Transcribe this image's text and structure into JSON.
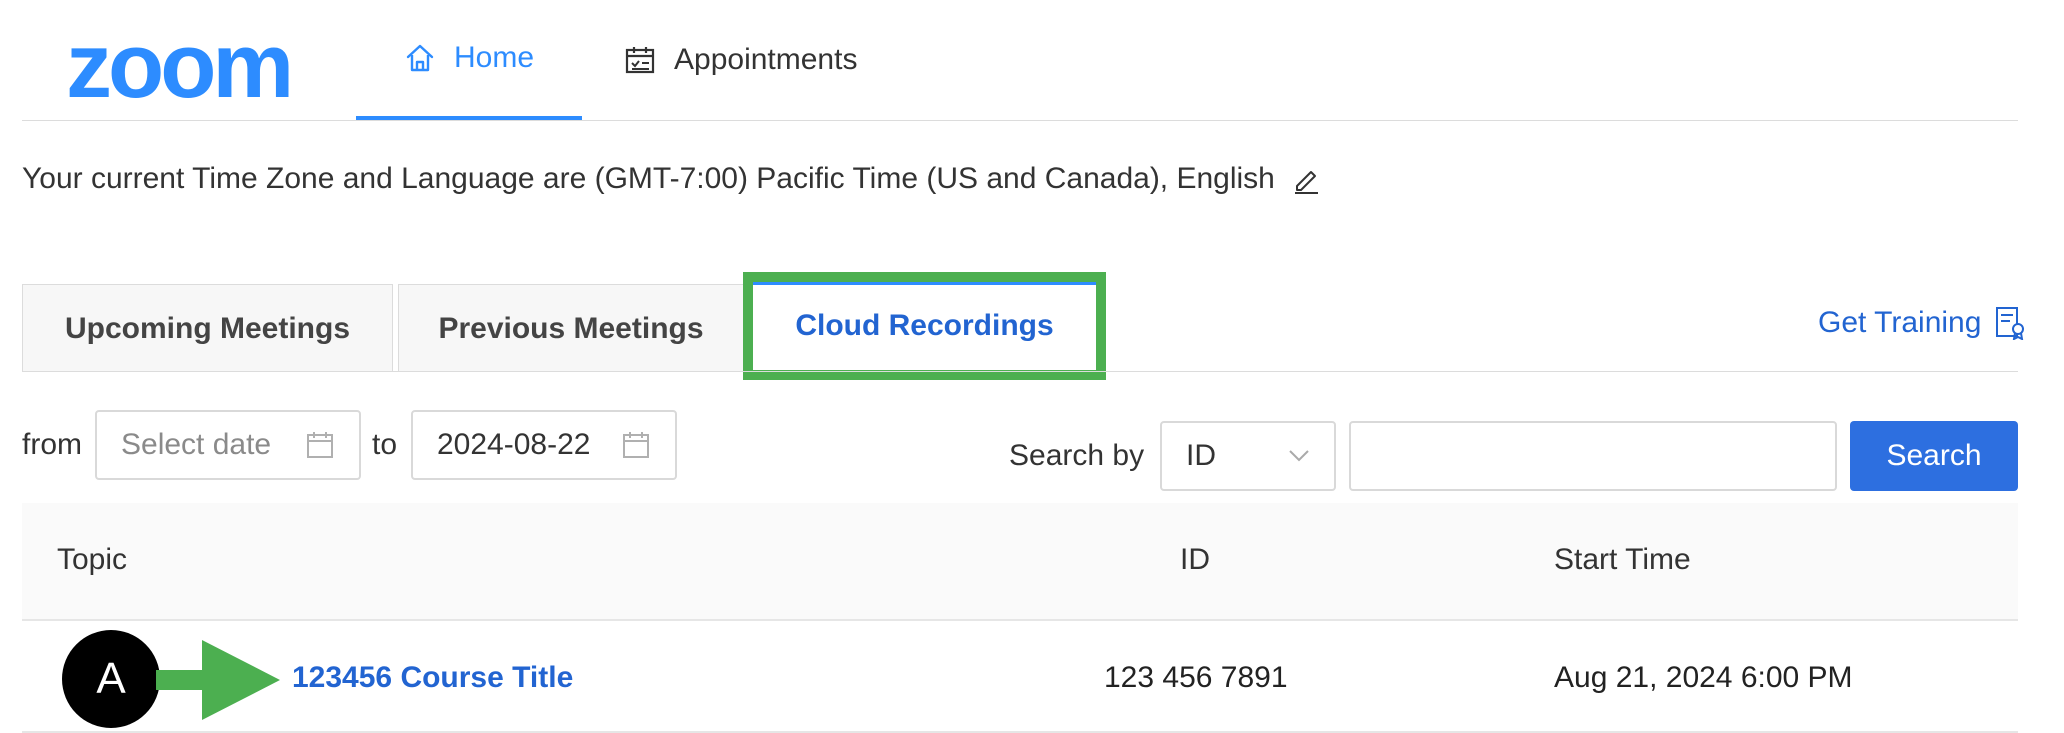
{
  "header": {
    "logo_text": "zoom",
    "nav": [
      {
        "label": "Home",
        "icon": "home-icon",
        "active": true
      },
      {
        "label": "Appointments",
        "icon": "calendar-check-icon",
        "active": false
      }
    ]
  },
  "timezone": {
    "text": "Your current Time Zone and Language are (GMT-7:00) Pacific Time (US and Canada), English"
  },
  "tabs": [
    {
      "label": "Upcoming Meetings",
      "active": false
    },
    {
      "label": "Previous Meetings",
      "active": false
    },
    {
      "label": "Cloud Recordings",
      "active": true
    }
  ],
  "get_training": {
    "label": "Get Training",
    "icon": "training-certificate-icon"
  },
  "filters": {
    "from_label": "from",
    "to_label": "to",
    "from_placeholder": "Select date",
    "to_value": "2024-08-22",
    "search_by_label": "Search by",
    "search_by_value": "ID",
    "search_value": "",
    "search_button": "Search"
  },
  "table": {
    "columns": [
      "Topic",
      "ID",
      "Start Time"
    ],
    "rows": [
      {
        "topic": "123456 Course Title",
        "id": "123 456 7891",
        "start_time": "Aug 21, 2024 6:00 PM"
      }
    ]
  },
  "annotation": {
    "marker_label": "A",
    "highlight_color": "#4CAF50",
    "arrow_color": "#4CAF50"
  },
  "colors": {
    "brand_blue": "#2D8CFF",
    "link_blue": "#2264D1",
    "button_blue": "#2D6FE0"
  }
}
